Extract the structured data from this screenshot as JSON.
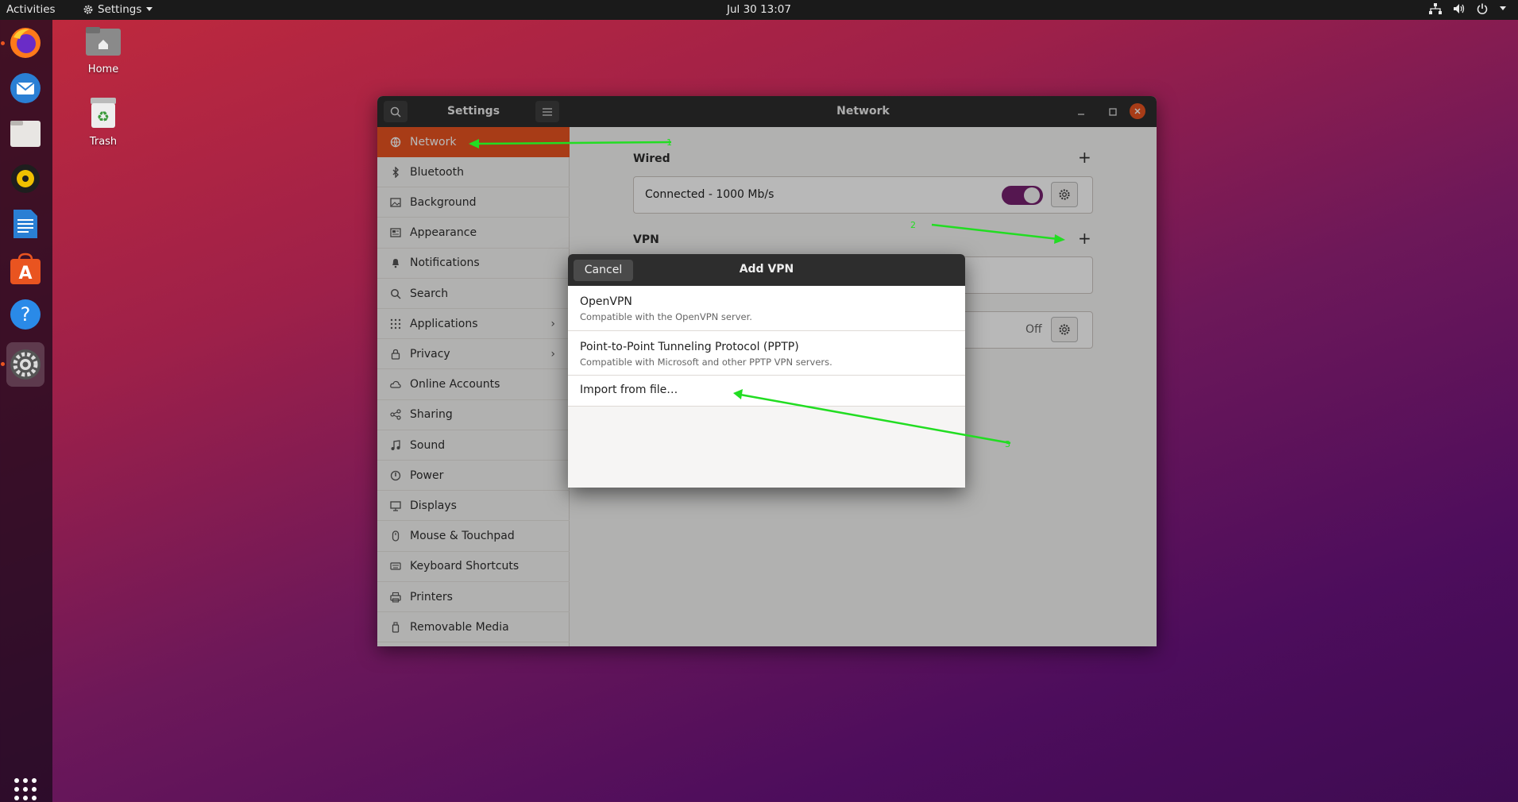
{
  "topbar": {
    "activities": "Activities",
    "app_menu": "Settings",
    "clock": "Jul 30  13:07"
  },
  "dock": {
    "apps": [
      "firefox-icon",
      "thunderbird-icon",
      "files-icon",
      "rhythmbox-icon",
      "libreoffice-writer-icon",
      "software-icon",
      "help-icon",
      "settings-icon"
    ],
    "show_apps": "grid-icon"
  },
  "desktop": {
    "home": "Home",
    "trash": "Trash"
  },
  "window": {
    "sidebar_title": "Settings",
    "title": "Network",
    "sidebar": [
      {
        "label": "Network",
        "icon": "network-icon"
      },
      {
        "label": "Bluetooth",
        "icon": "bluetooth-icon"
      },
      {
        "label": "Background",
        "icon": "background-icon"
      },
      {
        "label": "Appearance",
        "icon": "appearance-icon"
      },
      {
        "label": "Notifications",
        "icon": "bell-icon"
      },
      {
        "label": "Search",
        "icon": "search-icon"
      },
      {
        "label": "Applications",
        "icon": "apps-grid-icon"
      },
      {
        "label": "Privacy",
        "icon": "lock-icon"
      },
      {
        "label": "Online Accounts",
        "icon": "cloud-icon"
      },
      {
        "label": "Sharing",
        "icon": "share-icon"
      },
      {
        "label": "Sound",
        "icon": "music-note-icon"
      },
      {
        "label": "Power",
        "icon": "power-icon"
      },
      {
        "label": "Displays",
        "icon": "display-icon"
      },
      {
        "label": "Mouse & Touchpad",
        "icon": "mouse-icon"
      },
      {
        "label": "Keyboard Shortcuts",
        "icon": "keyboard-icon"
      },
      {
        "label": "Printers",
        "icon": "printer-icon"
      },
      {
        "label": "Removable Media",
        "icon": "usb-drive-icon"
      }
    ],
    "wired": {
      "title": "Wired",
      "status": "Connected - 1000 Mb/s",
      "toggle_on": true
    },
    "vpn": {
      "title": "VPN"
    },
    "proxy": {
      "status": "Off"
    }
  },
  "dialog": {
    "cancel": "Cancel",
    "title": "Add VPN",
    "options": [
      {
        "title": "OpenVPN",
        "subtitle": "Compatible with the OpenVPN server."
      },
      {
        "title": "Point-to-Point Tunneling Protocol (PPTP)",
        "subtitle": "Compatible with Microsoft and other PPTP VPN servers."
      },
      {
        "title": "Import from file…",
        "subtitle": ""
      }
    ]
  },
  "annotations": {
    "labels": [
      "1",
      "2",
      "3"
    ],
    "color": "#22dd22"
  },
  "colors": {
    "accent": "#e95420",
    "toggle": "#77216f",
    "header": "#2d2d2d"
  }
}
